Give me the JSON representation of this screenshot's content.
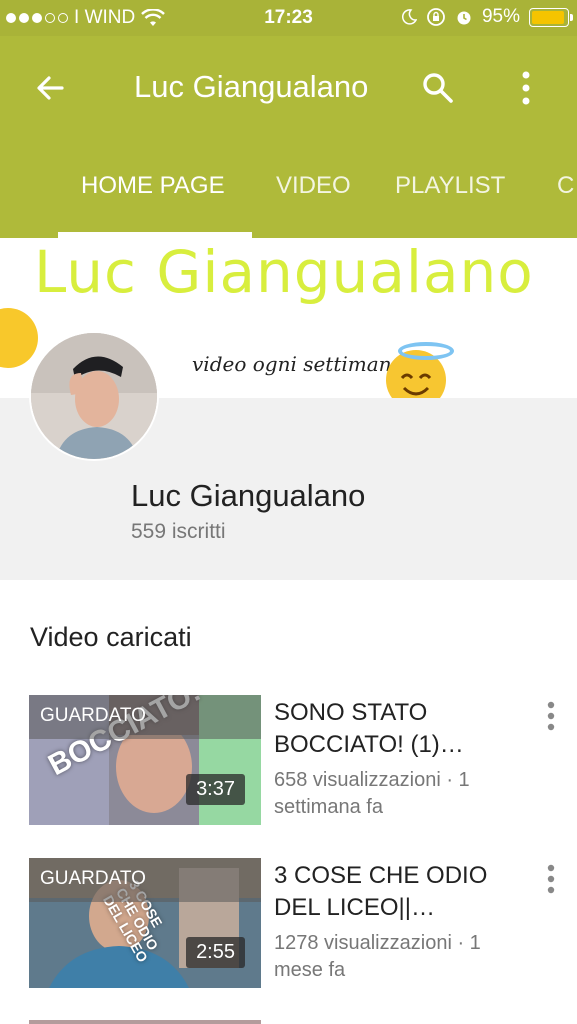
{
  "status_bar": {
    "carrier": "WIND",
    "time": "17:23",
    "battery": "95%",
    "battery_level": 0.95,
    "signal_bars": 3,
    "icons": [
      "wifi-icon",
      "moon-icon",
      "rotation-lock-icon",
      "alarm-icon",
      "battery-icon"
    ],
    "colors": {
      "background": "#a9b338",
      "battery_fill": "#f5c400"
    }
  },
  "app_bar": {
    "title": "Luc Giangualano",
    "back_icon": "arrow-back-icon",
    "search_icon": "search-icon",
    "more_icon": "more-vertical-icon",
    "color": "#afba3a"
  },
  "tabs": [
    {
      "label": "HOME PAGE",
      "active": true
    },
    {
      "label": "VIDEO",
      "active": false
    },
    {
      "label": "PLAYLIST",
      "active": false
    },
    {
      "label": "C",
      "active": false
    }
  ],
  "banner": {
    "title": "Luc Giangualano",
    "subtitle": "video ogni settimana",
    "title_color": "#d8ee3e"
  },
  "channel": {
    "name": "Luc Giangualano",
    "subscribers": "559 iscritti"
  },
  "section": {
    "title": "Video caricati"
  },
  "videos": [
    {
      "badge": "GUARDATO",
      "overlay": "BOCCIATO!",
      "duration": "3:37",
      "title": "SONO STATO BOCCIATO! (1)…",
      "meta": "658 visualizzazioni · 1 settimana fa"
    },
    {
      "badge": "GUARDATO",
      "overlay": "3 COSE CHE ODIO DEL LICEO",
      "duration": "2:55",
      "title": "3 COSE CHE ODIO DEL LICEO||…",
      "meta": "1278 visualizzazioni · 1 mese fa"
    }
  ]
}
